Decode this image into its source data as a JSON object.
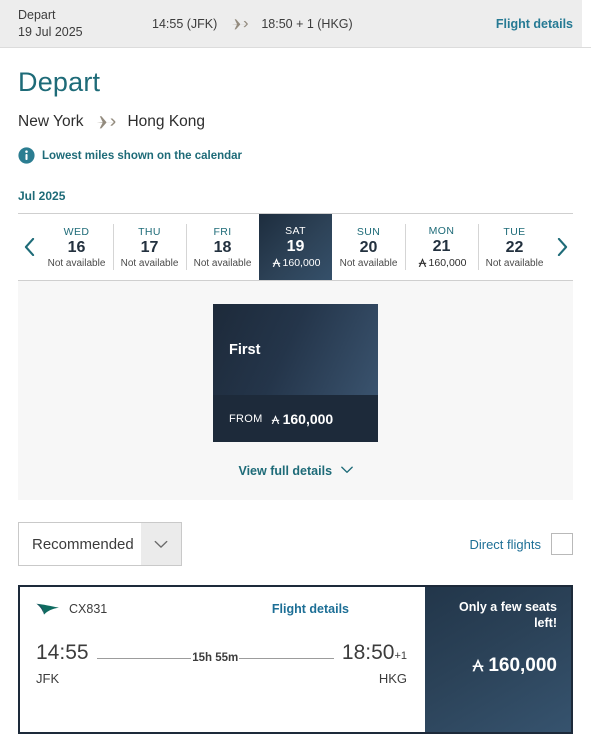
{
  "topbar": {
    "label": "Depart",
    "date": "19 Jul 2025",
    "depart_time": "14:55 (JFK)",
    "arrive_time": "18:50 + 1 (HKG)",
    "plane_icon": "airplane-icon",
    "flight_details_link": "Flight details"
  },
  "heading": {
    "title": "Depart",
    "origin": "New York",
    "destination": "Hong Kong",
    "route_icon": "airplane-icon",
    "info_icon": "info-icon",
    "note": "Lowest miles shown on the calendar"
  },
  "calendar": {
    "month": "Jul 2025",
    "prev_icon": "chevron-left-icon",
    "next_icon": "chevron-right-icon",
    "days": [
      {
        "dow": "WED",
        "num": "16",
        "status": "Not available",
        "price": null,
        "selected": false
      },
      {
        "dow": "THU",
        "num": "17",
        "status": "Not available",
        "price": null,
        "selected": false
      },
      {
        "dow": "FRI",
        "num": "18",
        "status": "Not available",
        "price": null,
        "selected": false
      },
      {
        "dow": "SAT",
        "num": "19",
        "status": null,
        "price": "160,000",
        "selected": true
      },
      {
        "dow": "SUN",
        "num": "20",
        "status": "Not available",
        "price": null,
        "selected": false
      },
      {
        "dow": "MON",
        "num": "21",
        "status": null,
        "price": "160,000",
        "selected": false
      },
      {
        "dow": "TUE",
        "num": "22",
        "status": "Not available",
        "price": null,
        "selected": false
      }
    ]
  },
  "fare": {
    "cabin": "First",
    "from_label": "FROM",
    "price": "160,000",
    "view_full_details": "View full details",
    "chevron_icon": "chevron-down-icon"
  },
  "controls": {
    "sort_value": "Recommended",
    "sort_chevron_icon": "chevron-down-icon",
    "direct_label": "Direct flights",
    "direct_checked": false
  },
  "flight": {
    "airline_icon": "cathay-brushwing-icon",
    "flight_number": "CX831",
    "details_link": "Flight details",
    "depart_time": "14:55",
    "depart_code": "JFK",
    "duration": "15h 55m",
    "arrive_time": "18:50",
    "arrive_day_offset": "+1",
    "arrive_code": "HKG",
    "seats_notice": "Only a few seats left!",
    "price": "160,000"
  },
  "colors": {
    "teal": "#1e6b78",
    "link_blue": "#1d6f96",
    "navy": "#1d2a3a",
    "panel_bg": "#f7f7f7",
    "topbar_bg": "#ededed",
    "brushwing_green": "#126a5f"
  }
}
